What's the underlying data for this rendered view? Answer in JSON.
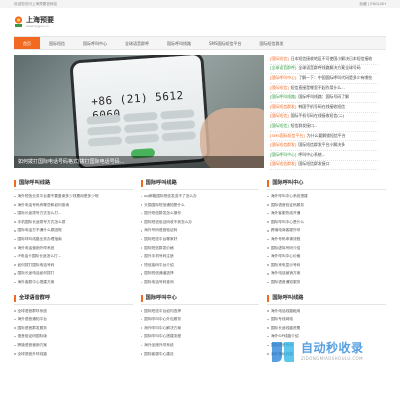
{
  "topbar": {
    "left_text": "欢迎您访问上海预要官网站",
    "right_text": "收藏 | ENGLISH"
  },
  "header": {
    "logo_name": "上海预要",
    "logo_url": "www.hyjyun.cn"
  },
  "nav": {
    "items": [
      {
        "label": "首页",
        "active": true
      },
      {
        "label": "国际短信",
        "active": false
      },
      {
        "label": "国际呼叫中心",
        "active": false
      },
      {
        "label": "全球语音群呼",
        "active": false
      },
      {
        "label": "国际呼叫线路",
        "active": false
      },
      {
        "label": "SMS国际短信平台",
        "active": false
      },
      {
        "label": "国际短信群发",
        "active": false
      }
    ]
  },
  "banner": {
    "phone_number": "+86 (21) 5612 6060",
    "caption": "如何拨打国际电话号码格式|拨打国际电话号码..."
  },
  "side_list": [
    {
      "tag": "[国际短信]",
      "text": "日本短信接收地区不可使国小解决日本短信接收"
    },
    {
      "tag": "[全球语音群呼]",
      "text": "全球语音群呼线路解决方案全球号码"
    },
    {
      "tag": "[国际呼叫中心]",
      "text": "了解一下：中国国际呼叫代码是多少有哪些"
    },
    {
      "tag": "[国际短信]",
      "text": "短信直接是哪里不起作用什么..."
    },
    {
      "tag": "[国际呼叫线路]",
      "text": "国际呼叫线路：国际号码了解"
    },
    {
      "tag": "[国际短信群发]",
      "text": "韩国手机号码在线接收短信"
    },
    {
      "tag": "[国际短信]",
      "text": "国际手机号码在线接收短信(二)"
    },
    {
      "tag": "[国际短信]",
      "text": "短信群发接口..."
    },
    {
      "tag": "[SMS国际短信平台]",
      "text": "为什么要解锁短信平台"
    },
    {
      "tag": "[国际短信群发]",
      "text": "国际短信群发平台小解决多"
    },
    {
      "tag": "[国际呼叫中心]",
      "text": "呼叫中心系统..."
    },
    {
      "tag": "[国际短信群发]",
      "text": "国际短信群发接口"
    }
  ],
  "sections_row1": [
    {
      "title": "国际呼叫线路",
      "items": [
        "海外短信业务平台要不要备案多少钱费用是多少呢",
        "海外电话号码有哪些和如何查询",
        "国际长途拨号方式怎么打...",
        "手机国际长途拨号方式怎么拨",
        "国际电话打不通什么原因呢",
        "国际呼叫线路业务办理指南",
        "海外电话营销外呼系统",
        "IP电话卡国际长途怎么打...",
        "如何拨打国际电话号码",
        "国际长途电话如何拨打",
        "海外客服中心搭建方案"
      ]
    },
    {
      "title": "国际呼叫线路",
      "items": [
        "qq邮箱国际短信发送不了怎么办",
        "天猫国际短信通知是什么",
        "国外短信群发怎么操作",
        "国际短信验证码收不到怎么办",
        "海外号码语音验证码",
        "国际短信平台哪家好",
        "国际短信群发价格",
        "国外手机号码注册",
        "短信接码平台介绍",
        "国际短信通道选择",
        "国际电话号码查询"
      ]
    },
    {
      "title": "国际呼叫中心",
      "items": [
        "海外呼叫中心系统搭建",
        "国际语音验证码服务",
        "海外客服热线开通",
        "国际呼叫中心是什么",
        "跨境电商客服外呼",
        "海外号码申请流程",
        "国际虚拟号码介绍",
        "海外呼叫中心价格",
        "国际来电显示号码",
        "海外电话营销方案",
        "国际语音通知服务"
      ]
    }
  ],
  "sections_row2": [
    {
      "title": "全球语音群呼",
      "items": [
        "全球语音群呼系统",
        "海外语音通知平台",
        "国际语音群发服务",
        "语音验证码国际版",
        "跨境语音营销方案",
        "全球语音外呼线路"
      ]
    },
    {
      "title": "国际呼叫中心",
      "items": [
        "国际短信平台如何选择",
        "国际呼叫中心外包服务",
        "海外呼叫中心解决方案",
        "国际呼叫中心搭建流程",
        "海外坐席外呼系统",
        "国际客服中心建设"
      ]
    },
    {
      "title": "国际呼叫线路",
      "items": [
        "海外电话线路租用",
        "国际专线网络",
        "国际长途线路资费",
        "海外SIP线路介绍",
        "国际语音专线",
        "海外落地线路"
      ]
    }
  ],
  "watermark": {
    "big": "自动秒收录",
    "small": "ZIDONGMIAOSHOULU.COM"
  },
  "colors": {
    "accent": "#f26a21",
    "green": "#35a046"
  }
}
